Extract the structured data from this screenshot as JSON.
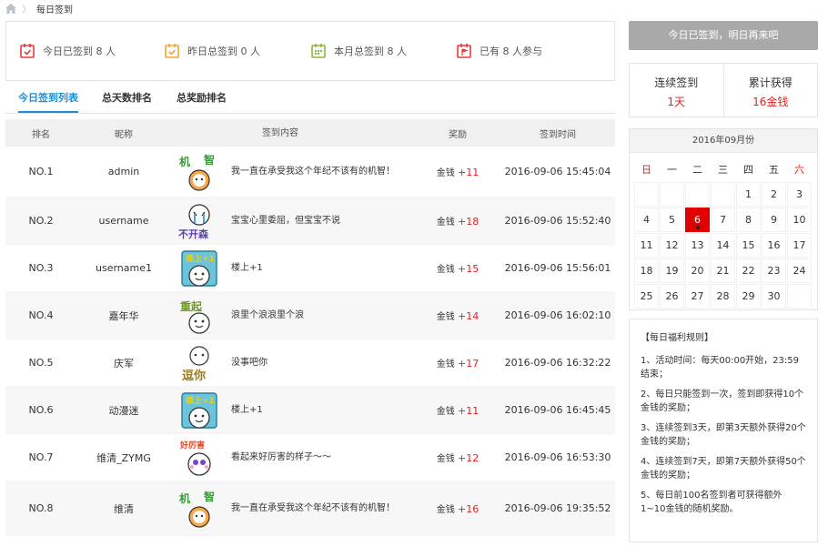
{
  "breadcrumb": {
    "current": "每日签到"
  },
  "stats": [
    {
      "icon": "calendar-check-icon",
      "color": "#e33b3b",
      "text": "今日已签到 8 人"
    },
    {
      "icon": "calendar-check-icon",
      "color": "#f0a732",
      "text": "昨日总签到 0 人"
    },
    {
      "icon": "calendar-grid-icon",
      "color": "#8cb83f",
      "text": "本月总签到 8 人"
    },
    {
      "icon": "calendar-flag-icon",
      "color": "#e33b3b",
      "text": "已有 8 人参与"
    }
  ],
  "tabs": [
    {
      "label": "今日签到列表",
      "active": true
    },
    {
      "label": "总天数排名",
      "active": false
    },
    {
      "label": "总奖励排名",
      "active": false
    }
  ],
  "table": {
    "headers": {
      "rank": "排名",
      "nick": "昵称",
      "content": "签到内容",
      "reward": "奖励",
      "time": "签到时间"
    },
    "rows": [
      {
        "rank": "NO.1",
        "nick": "admin",
        "emoji": "jizhi",
        "content": "我一直在承受我这个年纪不该有的机智！",
        "currency": "金钱",
        "amount": "+11",
        "time": "2016-09-06 15:45:04"
      },
      {
        "rank": "NO.2",
        "nick": "username",
        "emoji": "buchulai",
        "content": "宝宝心里委屈，但宝宝不说",
        "currency": "金钱",
        "amount": "+18",
        "time": "2016-09-06 15:52:40"
      },
      {
        "rank": "NO.3",
        "nick": "username1",
        "emoji": "loushang",
        "content": "楼上+1",
        "currency": "金钱",
        "amount": "+15",
        "time": "2016-09-06 15:56:01"
      },
      {
        "rank": "NO.4",
        "nick": "嘉年华",
        "emoji": "langli",
        "content": "浪里个浪浪里个浪",
        "currency": "金钱",
        "amount": "+14",
        "time": "2016-09-06 16:02:10"
      },
      {
        "rank": "NO.5",
        "nick": "庆军",
        "emoji": "meishi",
        "content": "没事吧你",
        "currency": "金钱",
        "amount": "+17",
        "time": "2016-09-06 16:32:22"
      },
      {
        "rank": "NO.6",
        "nick": "动漫迷",
        "emoji": "loushang",
        "content": "楼上+1",
        "currency": "金钱",
        "amount": "+11",
        "time": "2016-09-06 16:45:45"
      },
      {
        "rank": "NO.7",
        "nick": "维清_ZYMG",
        "emoji": "lihai",
        "content": "看起来好厉害的样子～～",
        "currency": "金钱",
        "amount": "+12",
        "time": "2016-09-06 16:53:30"
      },
      {
        "rank": "NO.8",
        "nick": "维清",
        "emoji": "jizhi",
        "content": "我一直在承受我这个年纪不该有的机智！",
        "currency": "金钱",
        "amount": "+16",
        "time": "2016-09-06 19:35:52"
      }
    ]
  },
  "sign_button": "今日已签到，明日再来吧",
  "summary": {
    "streak_label": "连续签到",
    "streak_value": "1天",
    "earned_label": "累计获得",
    "earned_value": "16金钱"
  },
  "calendar": {
    "title": "2016年09月份",
    "weekdays": [
      "日",
      "一",
      "二",
      "三",
      "四",
      "五",
      "六"
    ],
    "cells": [
      "",
      "",
      "",
      "",
      "1",
      "2",
      "3",
      "4",
      "5",
      "6",
      "7",
      "8",
      "9",
      "10",
      "11",
      "12",
      "13",
      "14",
      "15",
      "16",
      "17",
      "18",
      "19",
      "20",
      "21",
      "22",
      "23",
      "24",
      "25",
      "26",
      "27",
      "28",
      "29",
      "30",
      ""
    ],
    "today": "6",
    "accent": "#e00000"
  },
  "rules": {
    "title": "【每日福利规则】",
    "items": [
      "1、活动时间：每天00:00开始，23:59结束；",
      "2、每日只能签到一次，签到即获得10个金钱的奖励；",
      "3、连续签到3天，即第3天额外获得20个金钱的奖励；",
      "4、连续签到7天，即第7天额外获得50个金钱的奖励；",
      "5、每日前100名签到者可获得额外1~10金钱的随机奖励。"
    ]
  }
}
